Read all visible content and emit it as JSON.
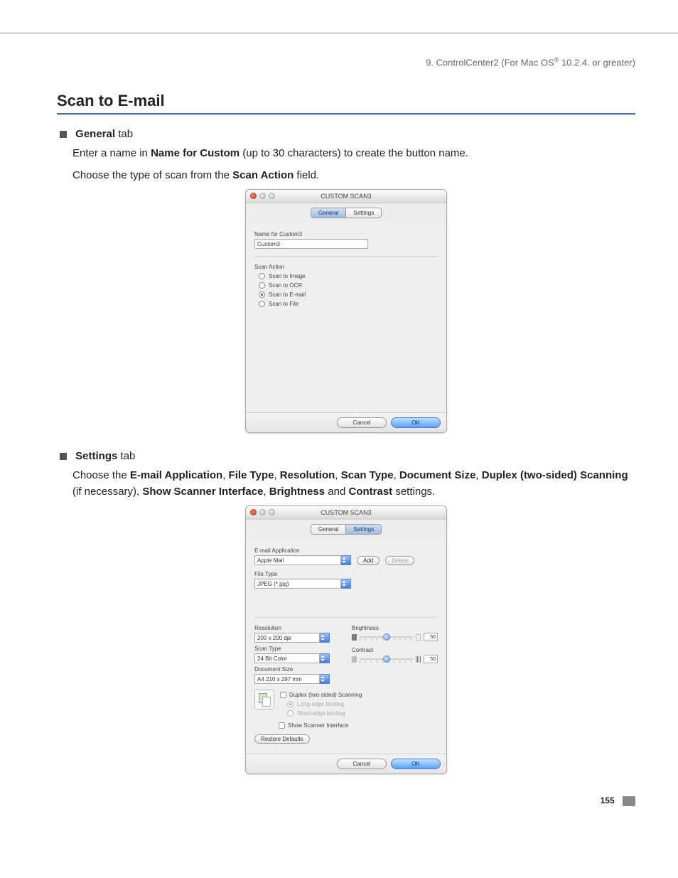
{
  "chapter": {
    "prefix": "9. ControlCenter2 (For Mac OS",
    "suffix": " 10.2.4. or greater)"
  },
  "section_title": "Scan to E-mail",
  "general_tab": {
    "heading_bold": "General",
    "heading_rest": " tab",
    "line1_a": "Enter a name in ",
    "line1_b": "Name for Custom",
    "line1_c": " (up to 30 characters) to create the button name.",
    "line2_a": "Choose the type of scan from the ",
    "line2_b": "Scan Action",
    "line2_c": " field."
  },
  "settings_tab": {
    "heading_bold": "Settings",
    "heading_rest": " tab",
    "line_a": "Choose the ",
    "b1": "E-mail Application",
    "c1": ", ",
    "b2": "File Type",
    "c2": ", ",
    "b3": "Resolution",
    "c3": ", ",
    "b4": "Scan Type",
    "c4": ", ",
    "b5": "Document Size",
    "c5": ", ",
    "b6": "Duplex (two-sided) Scanning",
    "c6": " (if necessary), ",
    "b7": "Show Scanner Interface",
    "c7": ", ",
    "b8": "Brightness",
    "c8": " and ",
    "b9": "Contrast",
    "c9": " settings."
  },
  "win1": {
    "title": "CUSTOM SCAN3",
    "tab_general": "General",
    "tab_settings": "Settings",
    "name_label": "Name for Custom3",
    "name_value": "Custom3",
    "scan_action_label": "Scan Action",
    "opt_image": "Scan to Image",
    "opt_ocr": "Scan to OCR",
    "opt_email": "Scan to E-mail",
    "opt_file": "Scan to File",
    "cancel": "Cancel",
    "ok": "OK"
  },
  "win2": {
    "title": "CUSTOM SCAN3",
    "tab_general": "General",
    "tab_settings": "Settings",
    "email_app_label": "E-mail Application",
    "email_app_value": "Apple Mail",
    "add": "Add",
    "delete": "Delete",
    "file_type_label": "File Type",
    "file_type_value": "JPEG (*.jpg)",
    "resolution_label": "Resolution",
    "resolution_value": "200 x 200 dpi",
    "scan_type_label": "Scan Type",
    "scan_type_value": "24 Bit Color",
    "doc_size_label": "Document Size",
    "doc_size_value": "A4  210 x 297 mm",
    "brightness_label": "Brightness",
    "brightness_value": "50",
    "contrast_label": "Contrast",
    "contrast_value": "50",
    "duplex": "Duplex (two-sided) Scanning",
    "long_edge": "Long-edge binding",
    "short_edge": "Short-edge binding",
    "show_scanner": "Show Scanner Interface",
    "restore": "Restore Defaults",
    "cancel": "Cancel",
    "ok": "OK"
  },
  "page_number": "155"
}
